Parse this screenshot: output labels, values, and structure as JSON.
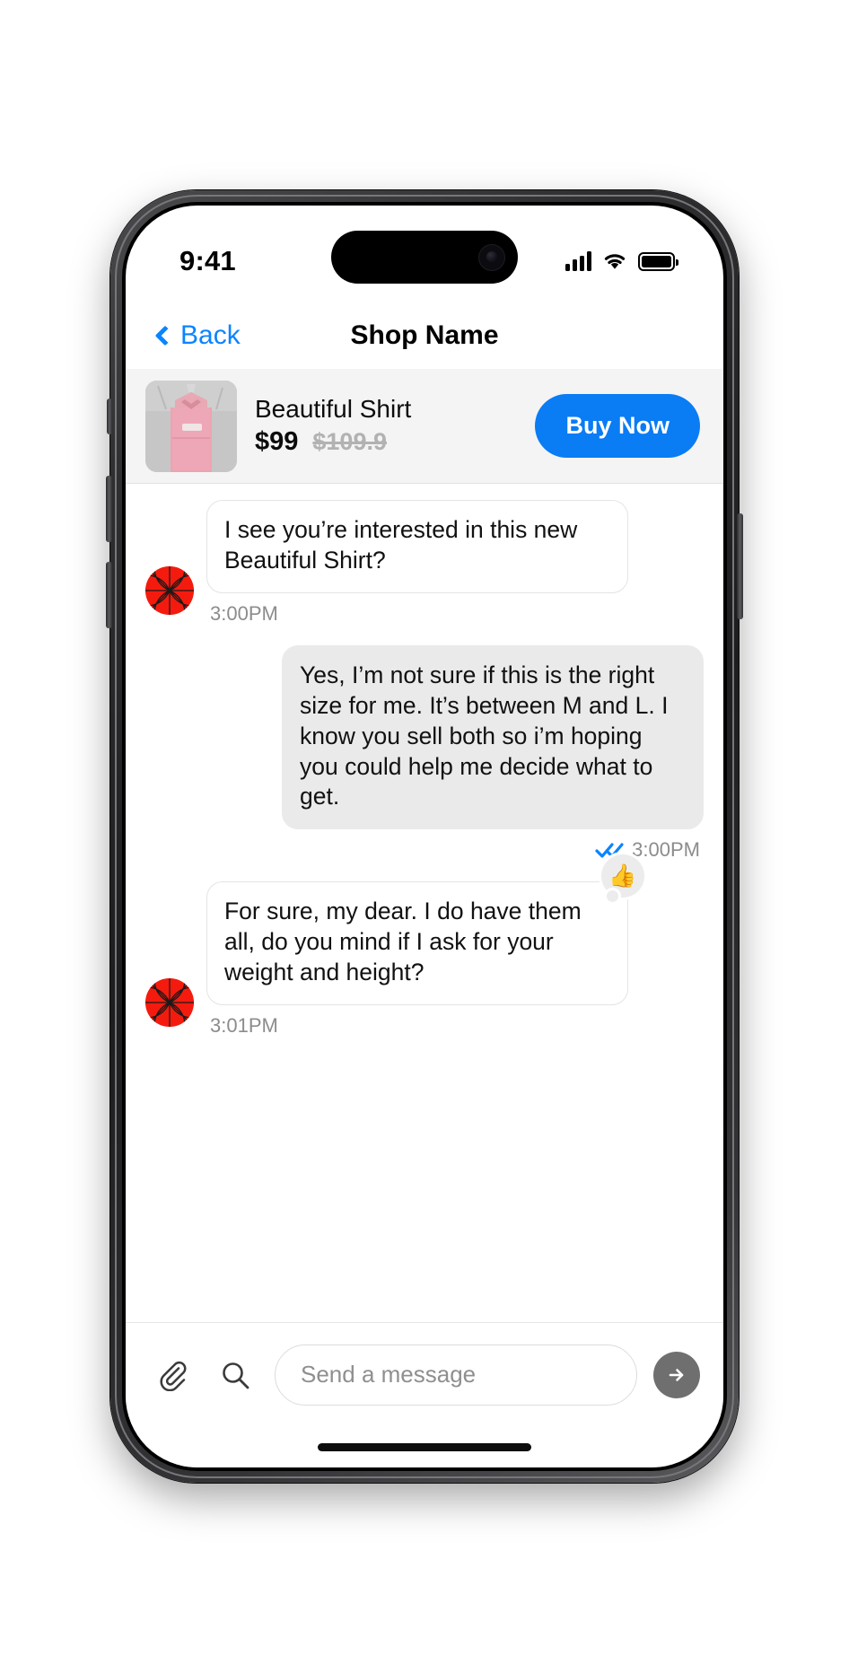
{
  "status_bar": {
    "time": "9:41",
    "signal_icon": "cellular-bars-icon",
    "wifi_icon": "wifi-icon",
    "battery_icon": "battery-full-icon"
  },
  "nav_bar": {
    "back_label": "Back",
    "back_icon": "chevron-left-icon",
    "title": "Shop Name"
  },
  "product_bar": {
    "thumbnail_icon": "product-thumbnail-pink-shirt",
    "title": "Beautiful Shirt",
    "price_current": "$99",
    "price_original": "$109.9",
    "buy_button_label": "Buy Now"
  },
  "conversation": {
    "messages": [
      {
        "direction": "incoming",
        "avatar_icon": "shop-avatar-icon",
        "text": "I see you’re interested in this new Beautiful Shirt?",
        "timestamp": "3:00PM"
      },
      {
        "direction": "outgoing",
        "text": "Yes, I’m not sure if this is the right size for me. It’s between M and L. I know you sell both so i’m hoping you could help me decide what to get.",
        "timestamp": "3:00PM",
        "read_receipt_icon": "double-check-icon"
      },
      {
        "direction": "incoming",
        "avatar_icon": "shop-avatar-icon",
        "text": "For sure, my dear. I do have them all, do you mind if I ask for your weight and height?",
        "timestamp": "3:01PM",
        "reaction": "👍",
        "reaction_icon": "thumbs-up-reaction-icon"
      }
    ]
  },
  "composer": {
    "attach_icon": "paperclip-icon",
    "search_icon": "search-icon",
    "placeholder": "Send a message",
    "value": "",
    "send_icon": "send-arrow-icon"
  },
  "colors": {
    "accent_blue": "#0a84ff",
    "buy_blue": "#0a7cf4",
    "avatar_red": "#f41b0e",
    "bubble_gray": "#eaeaea"
  }
}
